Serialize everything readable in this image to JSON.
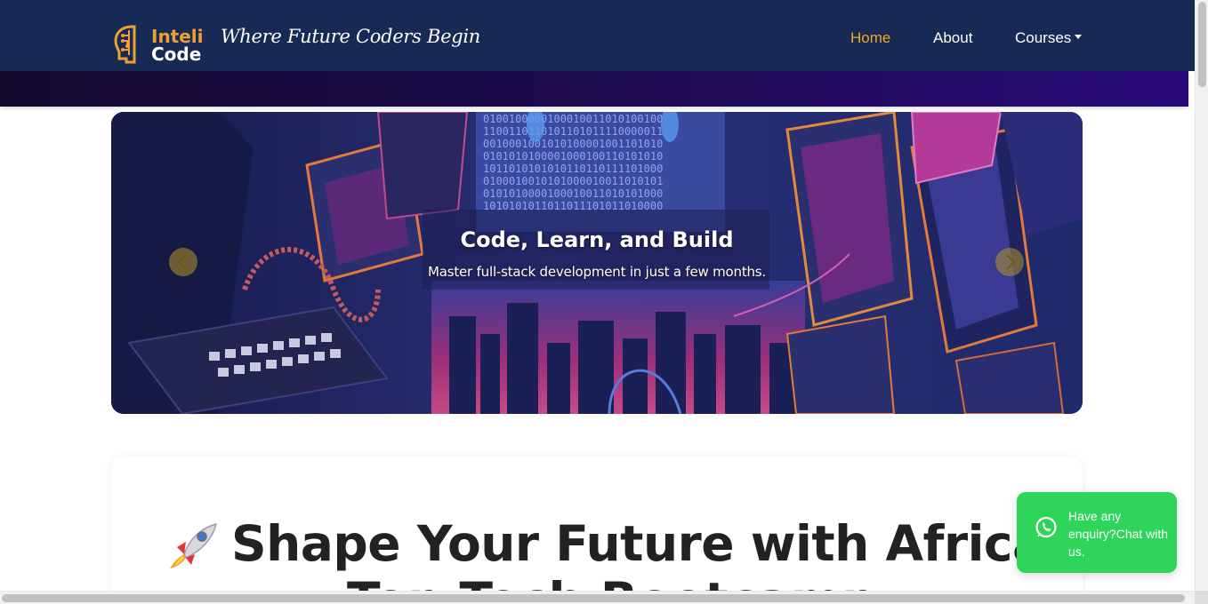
{
  "navbar": {
    "logo": {
      "line1": "Inteli",
      "line2": "Code"
    },
    "tagline": "Where Future Coders Begin",
    "items": [
      {
        "label": "Home",
        "active": true
      },
      {
        "label": "About",
        "active": false
      },
      {
        "label": "Courses",
        "active": false,
        "dropdown": true
      }
    ]
  },
  "hero": {
    "title": "Code, Learn, and Build",
    "subtitle": "Master full-stack development in just a few months.",
    "binary_rows": [
      "0100100000100010011010100100",
      "1100110110101101011110000011",
      "0010001001010100001001101010",
      "0101010100001000100110101010",
      "1011010101010110110111101000",
      "0100010010101000010011010101",
      "0101010000100010011010101000",
      "1010101011011011101011010000"
    ]
  },
  "content": {
    "headline": "Shape Your Future with Africa's",
    "headline_line2": "Top Tech Bootcamp"
  },
  "whatsapp": {
    "label": "Have any enquiry?Chat with us."
  },
  "colors": {
    "navbar_bg": "#172a55",
    "accent": "#f5a623",
    "whatsapp_green": "#2fd45a",
    "hero_bg": "#202a66"
  }
}
